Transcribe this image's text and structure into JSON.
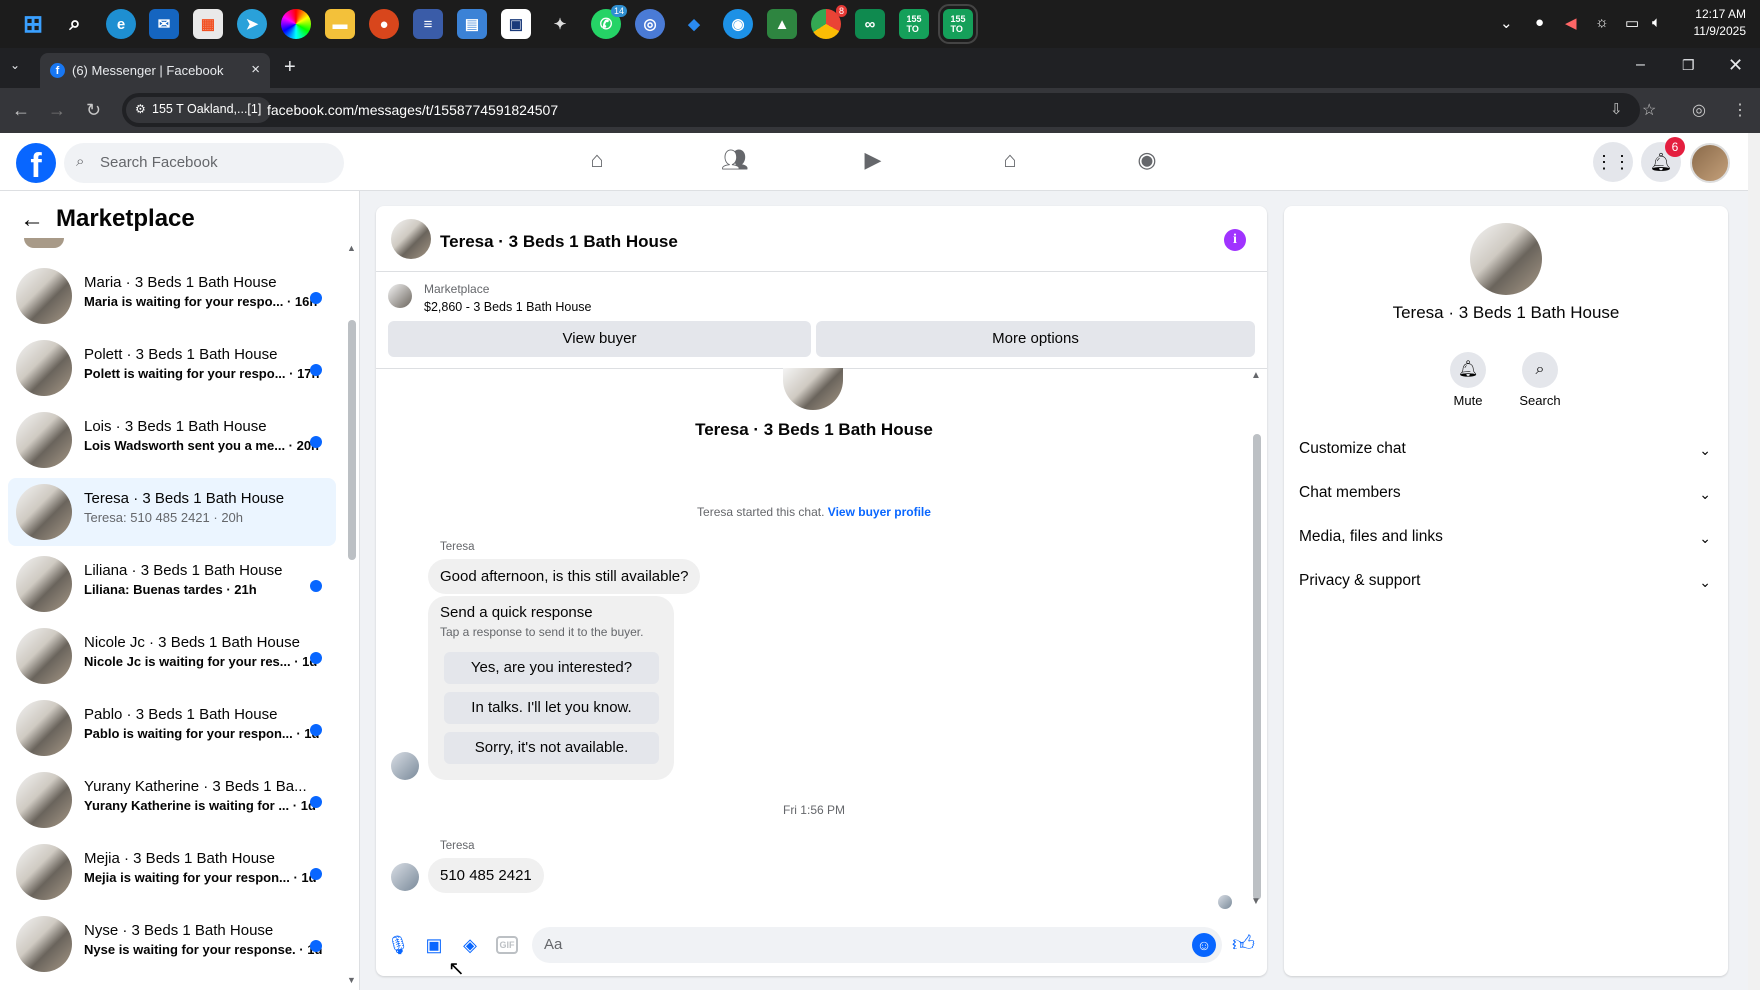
{
  "taskbar": {
    "clock_time": "12:17 AM",
    "clock_date": "11/9/2025",
    "badges": {
      "whatsapp": "14",
      "chrome": "8"
    },
    "apps": [
      "windows-start-icon",
      "search-icon",
      "edge-icon",
      "outlook-icon",
      "store-icon",
      "telegram-icon",
      "color-icon",
      "files-icon",
      "app-red-icon",
      "app-stack-icon",
      "notepad-icon",
      "app-grid-icon",
      "app-bird-icon",
      "whatsapp-icon",
      "app-blue-icon",
      "app-drop-icon",
      "app-docker-icon",
      "app-lock-icon",
      "chrome-icon",
      "app-infinity-icon",
      "app-155-icon",
      "app-155b-icon"
    ],
    "app_text": {
      "app155": "155\nTO",
      "app155b": "155\nTO"
    }
  },
  "browser": {
    "tab_title": "(6) Messenger | Facebook",
    "site_chip": "155 T Oakland,...[1]",
    "url": "facebook.com/messages/t/1558774591824507"
  },
  "fb_header": {
    "search_placeholder": "Search Facebook",
    "notifications_count": "6",
    "accent": "#0866ff"
  },
  "left_panel": {
    "title": "Marketplace",
    "conversations": [
      {
        "name": "Maria · 3 Beds 1 Bath House",
        "preview": "Maria is waiting for your respo... · 16h",
        "unread": true
      },
      {
        "name": "Polett · 3 Beds 1 Bath House",
        "preview": "Polett is waiting for your respo... · 17h",
        "unread": true
      },
      {
        "name": "Lois · 3 Beds 1 Bath House",
        "preview": "Lois Wadsworth sent you a me... · 20h",
        "unread": true
      },
      {
        "name": "Teresa · 3 Beds 1 Bath House",
        "preview": "Teresa: 510 485 2421 · 20h",
        "unread": false,
        "selected": true
      },
      {
        "name": "Liliana · 3 Beds 1 Bath House",
        "preview": "Liliana: Buenas tardes · 21h",
        "unread": true
      },
      {
        "name": "Nicole Jc · 3 Beds 1 Bath House",
        "preview": "Nicole Jc is waiting for your res... · 1d",
        "unread": true
      },
      {
        "name": "Pablo · 3 Beds 1 Bath House",
        "preview": "Pablo is waiting for your respon... · 1d",
        "unread": true
      },
      {
        "name": "Yurany Katherine · 3 Beds 1 Ba...",
        "preview": "Yurany Katherine is waiting for ... · 1d",
        "unread": true
      },
      {
        "name": "Mejia · 3 Beds 1 Bath House",
        "preview": "Mejia is waiting for your respon... · 1d",
        "unread": true
      },
      {
        "name": "Nyse · 3 Beds 1 Bath House",
        "preview": "Nyse is waiting for your response. · 1d",
        "unread": true
      }
    ]
  },
  "chat": {
    "header_name": "Teresa · 3 Beds 1 Bath House",
    "marketplace_label": "Marketplace",
    "listing": "$2,860 - 3 Beds 1 Bath House",
    "view_buyer": "View buyer",
    "more_options": "More options",
    "intro_name": "Teresa · 3 Beds 1 Bath House",
    "started_text": "Teresa started this chat.",
    "view_buyer_profile": "View buyer profile",
    "sender": "Teresa",
    "message1": "Good afternoon, is this still available?",
    "quick_title": "Send a quick response",
    "quick_sub": "Tap a response to send it to the buyer.",
    "quick_responses": [
      "Yes, are you interested?",
      "In talks. I'll let you know.",
      "Sorry, it's not available."
    ],
    "timestamp": "Fri 1:56 PM",
    "sender2": "Teresa",
    "message2": "510 485 2421",
    "composer_placeholder": "Aa"
  },
  "right_panel": {
    "name": "Teresa · 3 Beds 1 Bath House",
    "mute_label": "Mute",
    "search_label": "Search",
    "sections": [
      "Customize chat",
      "Chat members",
      "Media, files and links",
      "Privacy & support"
    ]
  }
}
